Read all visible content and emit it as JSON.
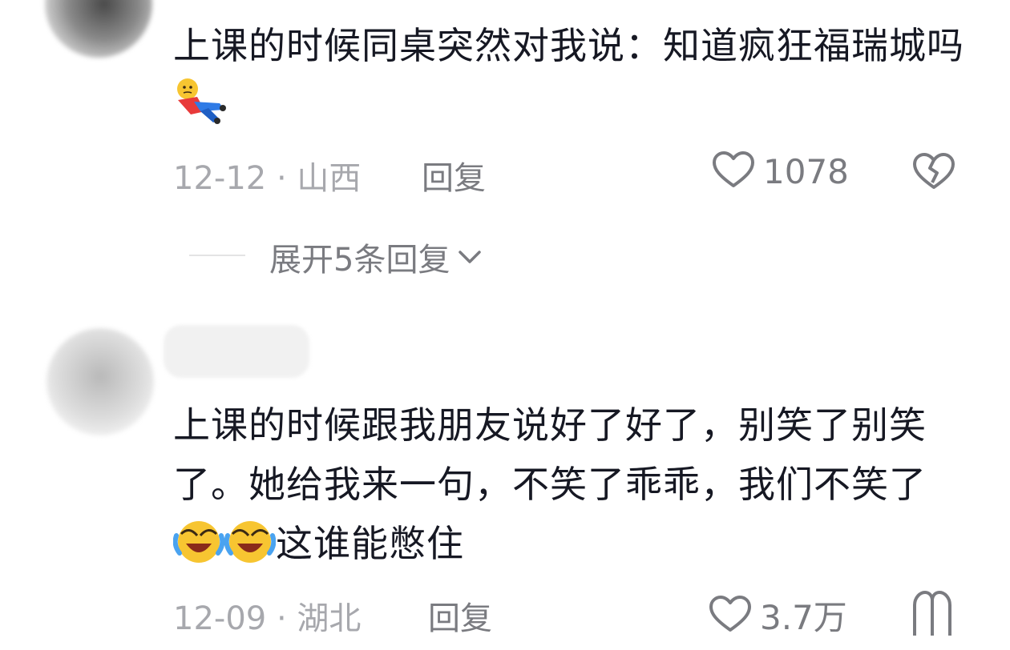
{
  "comments": [
    {
      "text": "上课的时候同桌突然对我说：知道疯狂福瑞城吗",
      "date": "12-12",
      "location": "山西",
      "reply_label": "回复",
      "likes": "1078",
      "expand_replies": "展开5条回复",
      "emoji": "falling-person-emoji"
    },
    {
      "text_part1": "上课的时候跟我朋友说好了好了，别笑了别笑了。她给我来一句，不笑了乖乖，我们不笑了",
      "text_part2": "这谁能憋住",
      "date": "12-09",
      "location": "湖北",
      "reply_label": "回复",
      "likes": "3.7万",
      "emoji": "laughing-crying-emoji"
    }
  ],
  "separator": "·",
  "colors": {
    "text": "#161823",
    "meta": "#a7a8ad",
    "action": "#7a7b80"
  }
}
